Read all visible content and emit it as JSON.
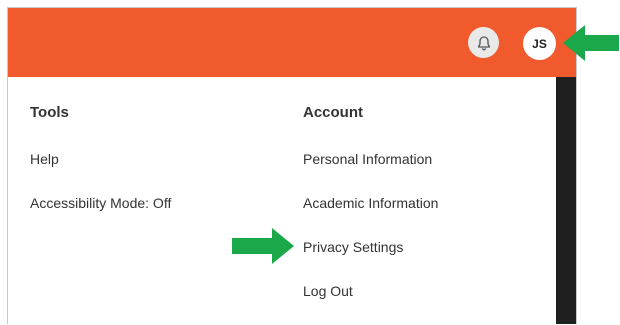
{
  "header": {
    "bell_icon": "bell-icon",
    "avatar_initials": "JS",
    "bar_color": "#f05a2c"
  },
  "menu": {
    "tools": {
      "heading": "Tools",
      "items": [
        "Help",
        "Accessibility Mode: Off"
      ]
    },
    "account": {
      "heading": "Account",
      "items": [
        "Personal Information",
        "Academic Information",
        "Privacy Settings",
        "Log Out"
      ]
    }
  },
  "annotations": {
    "arrow_color": "#1aa84b"
  }
}
